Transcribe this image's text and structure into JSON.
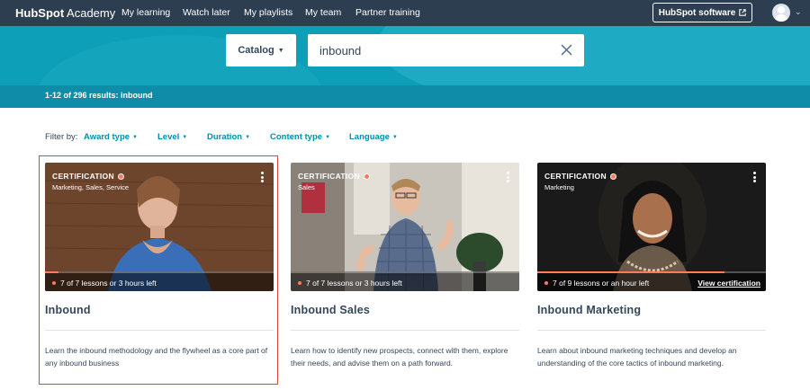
{
  "nav": {
    "brand_hub": "HubSpot",
    "brand_academy": " Academy",
    "links": [
      "My learning",
      "Watch later",
      "My playlists",
      "My team",
      "Partner training"
    ],
    "software_btn": "HubSpot software"
  },
  "search": {
    "catalog_label": "Catalog",
    "query": "inbound",
    "results_text": "1-12 of 296 results: inbound"
  },
  "filters": {
    "label": "Filter by:",
    "items": [
      "Award type",
      "Level",
      "Duration",
      "Content type",
      "Language"
    ]
  },
  "cards": [
    {
      "badge": "CERTIFICATION",
      "topics": "Marketing, Sales, Service",
      "progress_text": "7 of 7 lessons or 3 hours left",
      "progress_fraction": 0.06,
      "title": "Inbound",
      "description": "Learn the inbound methodology and the flywheel as a core part of any inbound business"
    },
    {
      "badge": "CERTIFICATION",
      "topics": "Sales",
      "progress_text": "7 of 7 lessons or 3 hours left",
      "progress_fraction": 0.0,
      "title": "Inbound Sales",
      "description": "Learn how to identify new prospects, connect with them, explore their needs, and advise them on a path forward."
    },
    {
      "badge": "CERTIFICATION",
      "topics": "Marketing",
      "progress_text": "7 of 9 lessons or an hour left",
      "progress_fraction": 0.82,
      "view_link": "View certification",
      "title": "Inbound Marketing",
      "description": "Learn about inbound marketing techniques and develop an understanding of the core tactics of inbound marketing."
    }
  ],
  "colors": {
    "nav_bg": "#2d3e50",
    "hero_bg": "#0e9fb8",
    "link": "#0091ae",
    "accent": "#ff7a59",
    "selection_outline": "#e0453a"
  }
}
